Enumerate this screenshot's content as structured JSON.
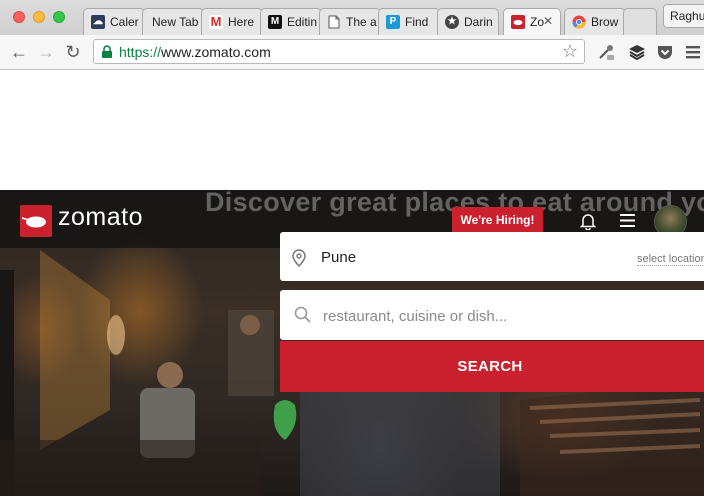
{
  "browser": {
    "tabs": [
      {
        "title": "Caler",
        "icon": "cloud-calendar-icon",
        "active": false
      },
      {
        "title": "New Tab",
        "icon": "",
        "active": false
      },
      {
        "title": "Here",
        "icon": "gmail-icon",
        "active": false
      },
      {
        "title": "Editin",
        "icon": "medium-icon",
        "active": false
      },
      {
        "title": "The a",
        "icon": "document-icon",
        "active": false
      },
      {
        "title": "Find",
        "icon": "p-app-icon",
        "active": false
      },
      {
        "title": "Darin",
        "icon": "star-circle-icon",
        "active": false
      },
      {
        "title": "Zo",
        "icon": "zomato-icon",
        "active": true
      },
      {
        "title": "Brow",
        "icon": "chrome-icon",
        "active": false
      }
    ],
    "close_glyph": "✕",
    "profile_name": "Raghu",
    "address_scheme": "https://",
    "address_rest": "www.zomato.com",
    "back_glyph": "←",
    "forward_glyph": "→",
    "reload_glyph": "↻",
    "star_glyph": "☆"
  },
  "page": {
    "tagline": "Discover great places to eat around you",
    "brand": "zomato",
    "hiring_label": "We're Hiring!",
    "location_value": "Pune",
    "select_location_label": "select location",
    "search_placeholder": "restaurant, cuisine or dish...",
    "search_button_label": "SEARCH",
    "brand_color": "#cb202d"
  }
}
